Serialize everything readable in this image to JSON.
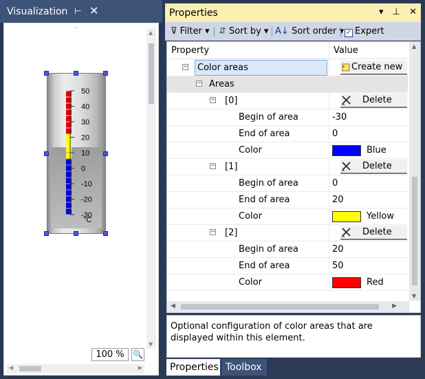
{
  "visualization": {
    "title": "Visualization",
    "pin_glyph": "⊢",
    "close_glyph": "✕",
    "zoom": "100 %",
    "thermometer": {
      "scale_labels": [
        "50",
        "40",
        "30",
        "20",
        "10",
        "0",
        "-10",
        "-20",
        "-30"
      ],
      "unit": "°C",
      "segment_colors": [
        "#e00000",
        "#e00000",
        "#e00000",
        "#e00000",
        "#e00000",
        "#e00000",
        "#e00000",
        "#ffff00",
        "#ffff00",
        "#ffff00",
        "#ffff00",
        "#0000dd",
        "#0000dd",
        "#0000dd",
        "#0000dd",
        "#0000dd",
        "#0000dd",
        "#0000dd",
        "#0000dd",
        "#0000dd"
      ]
    }
  },
  "properties": {
    "title": "Properties",
    "toolbar": {
      "filter": "Filter",
      "sort_by": "Sort by",
      "sort_order": "Sort order",
      "expert": "Expert"
    },
    "columns": {
      "property": "Property",
      "value": "Value"
    },
    "color_areas_label": "Color areas",
    "create_new": "Create new",
    "areas_label": "Areas",
    "delete_label": "Delete",
    "items": [
      {
        "index": "[0]",
        "begin_label": "Begin of area",
        "begin": "-30",
        "end_label": "End of area",
        "end": "0",
        "color_label": "Color",
        "color_name": "Blue",
        "color_hex": "#0000ff"
      },
      {
        "index": "[1]",
        "begin_label": "Begin of area",
        "begin": "0",
        "end_label": "End of area",
        "end": "20",
        "color_label": "Color",
        "color_name": "Yellow",
        "color_hex": "#ffff00"
      },
      {
        "index": "[2]",
        "begin_label": "Begin of area",
        "begin": "20",
        "end_label": "End of area",
        "end": "50",
        "color_label": "Color",
        "color_name": "Red",
        "color_hex": "#ff0000"
      }
    ],
    "description": "Optional configuration of color areas that are displayed within this element."
  },
  "tabs": {
    "properties": "Properties",
    "toolbox": "Toolbox"
  }
}
